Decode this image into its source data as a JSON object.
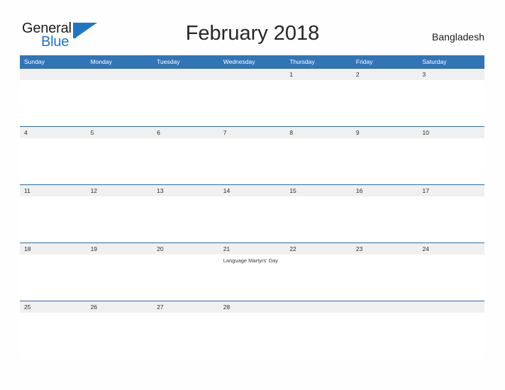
{
  "logo": {
    "line1": "General",
    "line2": "Blue",
    "flag_icon": "flag-triangle-icon"
  },
  "header": {
    "title": "February 2018",
    "country": "Bangladesh"
  },
  "colors": {
    "header_blue": "#3275b7",
    "row_divider_blue": "#2e6da4",
    "date_strip_gray": "#f0f0f0",
    "logo_blue": "#1f77c4",
    "text_dark": "#262626"
  },
  "calendar": {
    "weekdays": [
      "Sunday",
      "Monday",
      "Tuesday",
      "Wednesday",
      "Thursday",
      "Friday",
      "Saturday"
    ],
    "weeks": [
      [
        {
          "day": "",
          "event": ""
        },
        {
          "day": "",
          "event": ""
        },
        {
          "day": "",
          "event": ""
        },
        {
          "day": "",
          "event": ""
        },
        {
          "day": "1",
          "event": ""
        },
        {
          "day": "2",
          "event": ""
        },
        {
          "day": "3",
          "event": ""
        }
      ],
      [
        {
          "day": "4",
          "event": ""
        },
        {
          "day": "5",
          "event": ""
        },
        {
          "day": "6",
          "event": ""
        },
        {
          "day": "7",
          "event": ""
        },
        {
          "day": "8",
          "event": ""
        },
        {
          "day": "9",
          "event": ""
        },
        {
          "day": "10",
          "event": ""
        }
      ],
      [
        {
          "day": "11",
          "event": ""
        },
        {
          "day": "12",
          "event": ""
        },
        {
          "day": "13",
          "event": ""
        },
        {
          "day": "14",
          "event": ""
        },
        {
          "day": "15",
          "event": ""
        },
        {
          "day": "16",
          "event": ""
        },
        {
          "day": "17",
          "event": ""
        }
      ],
      [
        {
          "day": "18",
          "event": ""
        },
        {
          "day": "19",
          "event": ""
        },
        {
          "day": "20",
          "event": ""
        },
        {
          "day": "21",
          "event": "Language Martyrs' Day"
        },
        {
          "day": "22",
          "event": ""
        },
        {
          "day": "23",
          "event": ""
        },
        {
          "day": "24",
          "event": ""
        }
      ],
      [
        {
          "day": "25",
          "event": ""
        },
        {
          "day": "26",
          "event": ""
        },
        {
          "day": "27",
          "event": ""
        },
        {
          "day": "28",
          "event": ""
        },
        {
          "day": "",
          "event": ""
        },
        {
          "day": "",
          "event": ""
        },
        {
          "day": "",
          "event": ""
        }
      ]
    ]
  }
}
